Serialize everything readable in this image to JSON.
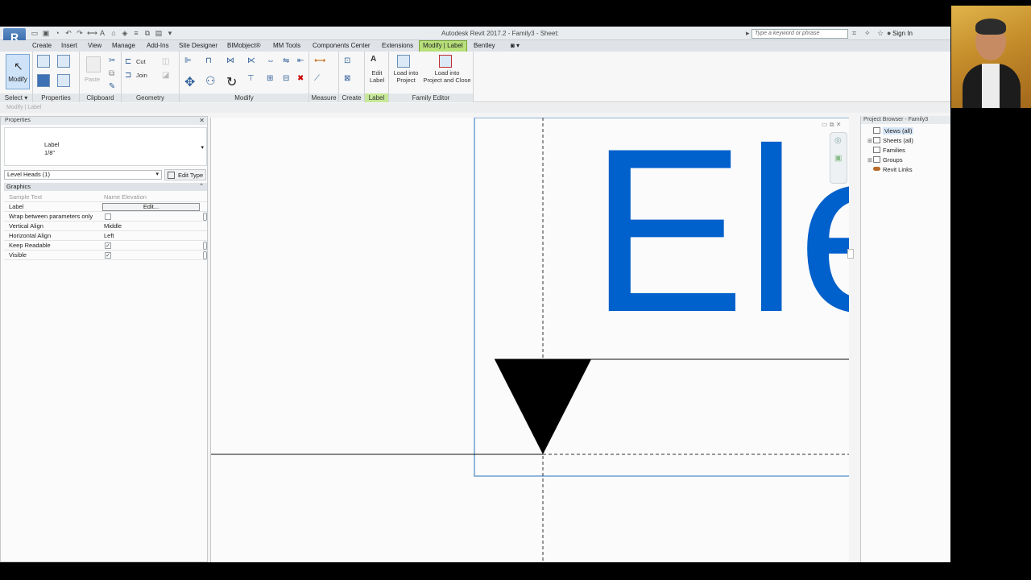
{
  "titlebar": {
    "app_icon": "R",
    "title": "Autodesk Revit 2017.2 -    Family3 - Sheet:",
    "search_placeholder": "Type a keyword or phrase",
    "sign_in": "Sign In"
  },
  "tabs": [
    "Create",
    "Insert",
    "View",
    "Manage",
    "Add-Ins",
    "Site Designer",
    "BIMobject®",
    "MM Tools",
    "Components Center",
    "Extensions",
    "Modify | Label",
    "Bentley"
  ],
  "active_tab": "Modify | Label",
  "ribbon": {
    "modify": "Modify",
    "paste": "Paste",
    "cut": "Cut",
    "join": "Join",
    "edit_label": [
      "Edit",
      "Label"
    ],
    "load_project": [
      "Load into",
      "Project"
    ],
    "load_close": [
      "Load into",
      "Project and Close"
    ],
    "panels": {
      "select": "Select ▾",
      "properties": "Properties",
      "clipboard": "Clipboard",
      "geometry": "Geometry",
      "modify": "Modify",
      "measure": "Measure",
      "create": "Create",
      "label": "Label",
      "family_editor": "Family Editor"
    }
  },
  "context_bar": "Modify | Label",
  "properties": {
    "title": "Properties",
    "type_line1": "Label",
    "type_line2": "1/8\"",
    "instance": "Level Heads (1)",
    "edit_type": "Edit Type",
    "group": "Graphics",
    "rows": [
      {
        "key": "Sample Text",
        "value": "Name Elevation",
        "kind": "grey"
      },
      {
        "key": "Label",
        "value": "Edit...",
        "kind": "button"
      },
      {
        "key": "Wrap between parameters only",
        "value": "",
        "kind": "check-off"
      },
      {
        "key": "Vertical Align",
        "value": "Middle",
        "kind": "text"
      },
      {
        "key": "Horizontal Align",
        "value": "Left",
        "kind": "text"
      },
      {
        "key": "Keep Readable",
        "value": "✓",
        "kind": "check-on"
      },
      {
        "key": "Visible",
        "value": "✓",
        "kind": "check-on"
      }
    ]
  },
  "canvas": {
    "label_text": "Ele",
    "label_color": "#0060cc"
  },
  "browser": {
    "title": "Project Browser - Family3",
    "items": [
      {
        "label": "Views (all)",
        "expand": "",
        "selected": true
      },
      {
        "label": "Sheets (all)",
        "expand": "⊞",
        "selected": false
      },
      {
        "label": "Families",
        "expand": "",
        "selected": false
      },
      {
        "label": "Groups",
        "expand": "⊞",
        "selected": false
      },
      {
        "label": "Revit Links",
        "expand": "",
        "selected": false,
        "link": true
      }
    ]
  },
  "colors": {
    "active_tab": "#b8e07a",
    "label_blue": "#0060cc",
    "ribbon_icon": "#2f5f9a"
  }
}
